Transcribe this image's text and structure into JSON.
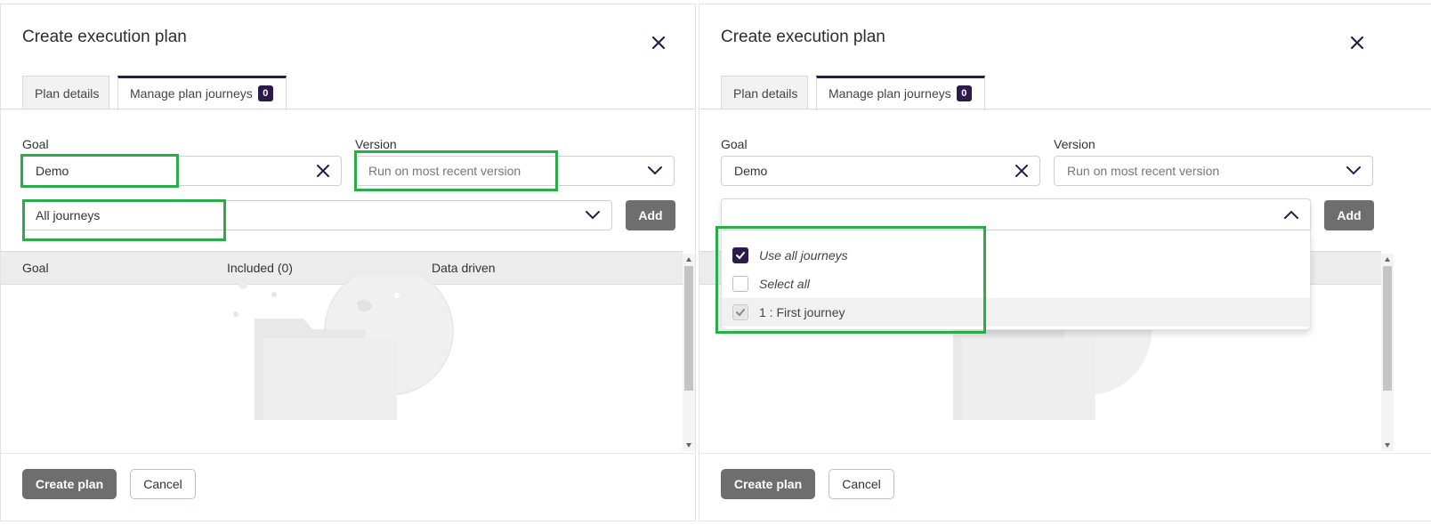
{
  "left": {
    "title": "Create execution plan",
    "tabs": [
      {
        "label": "Plan details"
      },
      {
        "label": "Manage plan journeys",
        "badge": "0"
      }
    ],
    "goal": {
      "label": "Goal",
      "value": "Demo"
    },
    "version": {
      "label": "Version",
      "placeholder": "Run on most recent version"
    },
    "journeys": {
      "value": "All journeys"
    },
    "add_label": "Add",
    "table": {
      "columns": [
        "Goal",
        "Included (0)",
        "Data driven"
      ]
    },
    "footer": {
      "create": "Create plan",
      "cancel": "Cancel"
    }
  },
  "right": {
    "title": "Create execution plan",
    "tabs": [
      {
        "label": "Plan details"
      },
      {
        "label": "Manage plan journeys",
        "badge": "0"
      }
    ],
    "goal": {
      "label": "Goal",
      "value": "Demo"
    },
    "version": {
      "label": "Version",
      "placeholder": "Run on most recent version"
    },
    "add_label": "Add",
    "dropdown": {
      "options": [
        {
          "label": "Use all journeys",
          "checked": true
        },
        {
          "label": "Select all",
          "checked": false
        },
        {
          "label": "1 : First journey",
          "checked": true,
          "disabled": true
        }
      ]
    },
    "footer": {
      "create": "Create plan",
      "cancel": "Cancel"
    }
  },
  "colors": {
    "accent": "#2c1a4a",
    "highlight": "#2aac48",
    "button_gray": "#6e6e6e"
  },
  "icons": [
    "close-icon",
    "clear-icon",
    "chevron-down-icon",
    "chevron-up-icon",
    "check-icon",
    "empty-state-illustration"
  ]
}
